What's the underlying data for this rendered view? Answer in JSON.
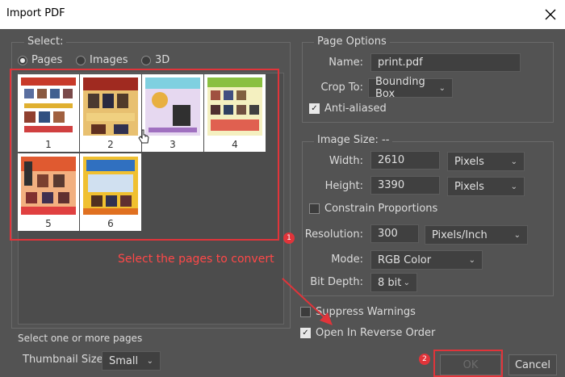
{
  "window": {
    "title": "Import PDF",
    "close_icon": "close-icon"
  },
  "select": {
    "heading": "Select:",
    "options": [
      {
        "label": "Pages",
        "selected": true
      },
      {
        "label": "Images",
        "selected": false
      },
      {
        "label": "3D",
        "selected": false
      }
    ],
    "pages": [
      "1",
      "2",
      "3",
      "4",
      "5",
      "6"
    ],
    "annotation": "Select the pages to convert",
    "hint": "Select one or more pages",
    "thumb_size_label": "Thumbnail Size:",
    "thumb_size_value": "Small"
  },
  "page_options": {
    "heading": "Page Options",
    "name_label": "Name:",
    "name_value": "print.pdf",
    "crop_label": "Crop To:",
    "crop_value": "Bounding Box",
    "antialias_label": "Anti-aliased",
    "antialias_checked": true
  },
  "image_size": {
    "heading": "Image Size: --",
    "width_label": "Width:",
    "width_value": "2610",
    "width_unit": "Pixels",
    "height_label": "Height:",
    "height_value": "3390",
    "height_unit": "Pixels",
    "constrain_label": "Constrain Proportions",
    "constrain_checked": false,
    "resolution_label": "Resolution:",
    "resolution_value": "300",
    "resolution_unit": "Pixels/Inch",
    "mode_label": "Mode:",
    "mode_value": "RGB Color",
    "bitdepth_label": "Bit Depth:",
    "bitdepth_value": "8 bit"
  },
  "options": {
    "suppress_label": "Suppress Warnings",
    "suppress_checked": false,
    "reverse_label": "Open In Reverse Order",
    "reverse_checked": true
  },
  "buttons": {
    "ok": "OK",
    "cancel": "Cancel"
  },
  "callouts": {
    "one": "1",
    "two": "2"
  },
  "colors": {
    "accent_red": "#e0343a",
    "dialog_bg": "#535353"
  }
}
